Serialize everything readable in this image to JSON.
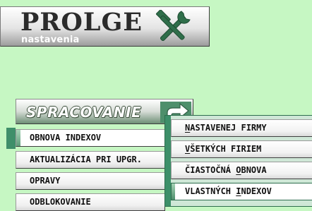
{
  "logo": {
    "title": "PROLGE",
    "subtitle": "nastavenia",
    "icon": "hammer-wrench-icon"
  },
  "section": {
    "label": "SPRACOVANIE",
    "icon": "arrow-turn-right-icon"
  },
  "menu": {
    "items": [
      {
        "label": "OBNOVA INDEXOV",
        "active": true
      },
      {
        "label": "AKTUALIZÁCIA PRI UPGR."
      },
      {
        "label": "OPRAVY"
      },
      {
        "label": "ODBLOKOVANIE"
      }
    ]
  },
  "submenu": {
    "items": [
      {
        "pre": "",
        "key": "N",
        "post": "ASTAVENEJ FIRMY"
      },
      {
        "pre": "",
        "key": "V",
        "post": "ŠETKÝCH FIRIEM"
      },
      {
        "pre": "ČIASTOČNÁ ",
        "key": "O",
        "post": "BNOVA"
      },
      {
        "pre": "VLASTNÝCH ",
        "key": "I",
        "post": "NDEXOV",
        "selected": true
      }
    ]
  },
  "colors": {
    "background": "#c6f7c3",
    "accent": "#3f8f6a",
    "tools_icon": "#2f6e4a"
  }
}
